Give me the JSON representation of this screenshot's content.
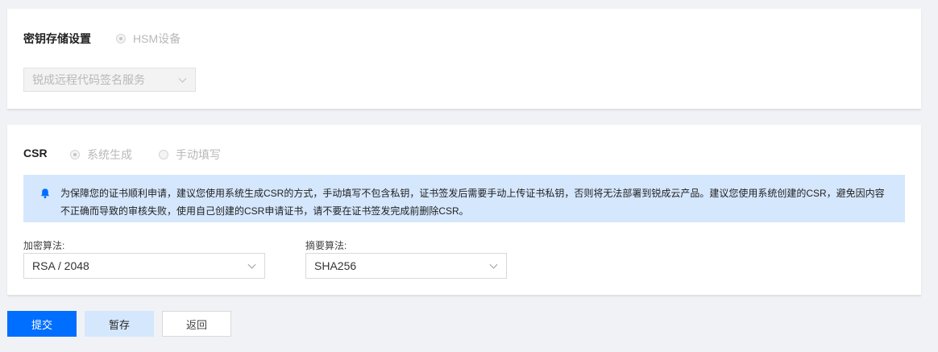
{
  "key_storage": {
    "label": "密钥存储设置",
    "option_hsm": "HSM设备",
    "service_select": "锐成远程代码签名服务"
  },
  "csr": {
    "label": "CSR",
    "option_system": "系统生成",
    "option_manual": "手动填写",
    "notice_line1": "为保障您的证书顺利申请，建议您使用系统生成CSR的方式，手动填写不包含私钥，证书签发后需要手动上传证书私钥，否则将无法部署到锐成云产品。建议您使用系统创建的CSR，避免因内容",
    "notice_line2": "不正确而导致的审核失败，使用自己创建的CSR申请证书，请不要在证书签发完成前删除CSR。",
    "encryption_label": "加密算法:",
    "encryption_value": "RSA / 2048",
    "digest_label": "摘要算法:",
    "digest_value": "SHA256"
  },
  "actions": {
    "submit": "提交",
    "save_draft": "暂存",
    "back": "返回"
  },
  "colors": {
    "primary": "#006eff",
    "notice_bg": "#d5e7fd",
    "page_bg": "#f1f2f5"
  },
  "icons": {
    "notice": "bell-icon",
    "dropdown": "chevron-down-icon"
  }
}
